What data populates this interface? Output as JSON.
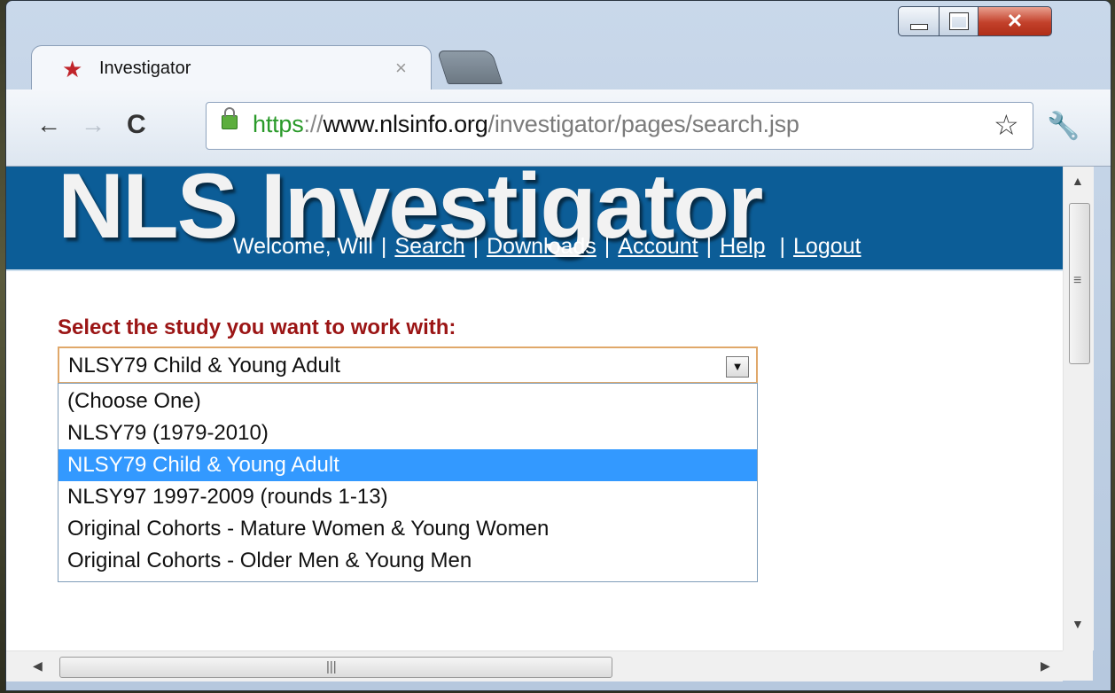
{
  "browser": {
    "tab_title": "Investigator",
    "tab_close": "×",
    "url_scheme": "https",
    "url_sep": "://",
    "url_host": "www.nlsinfo.org",
    "url_path": "/investigator/pages/search.jsp"
  },
  "page": {
    "logo": "NLS Investigator",
    "welcome": "Welcome, Will",
    "nav": {
      "search": "Search",
      "downloads": "Downloads",
      "account": "Account",
      "help": "Help",
      "logout": "Logout"
    },
    "study_label": "Select the study you want to work with:",
    "study_selected": "NLSY79 Child & Young Adult",
    "study_options": [
      "(Choose One)",
      "NLSY79 (1979-2010)",
      "NLSY79 Child & Young Adult",
      "NLSY97 1997-2009 (rounds 1-13)",
      "Original Cohorts - Mature Women & Young Women",
      "Original Cohorts - Older Men & Young Men"
    ],
    "highlighted_option_index": 2
  },
  "colors": {
    "banner": "#0c5d97",
    "label": "#9b1515",
    "highlight": "#3399ff",
    "https_green": "#2a9a2a"
  },
  "icons": {
    "favicon": "star-icon",
    "back": "back-arrow-icon",
    "forward": "forward-arrow-icon",
    "reload": "reload-icon",
    "lock": "lock-icon",
    "bookmark": "star-outline-icon",
    "menu": "wrench-icon"
  }
}
